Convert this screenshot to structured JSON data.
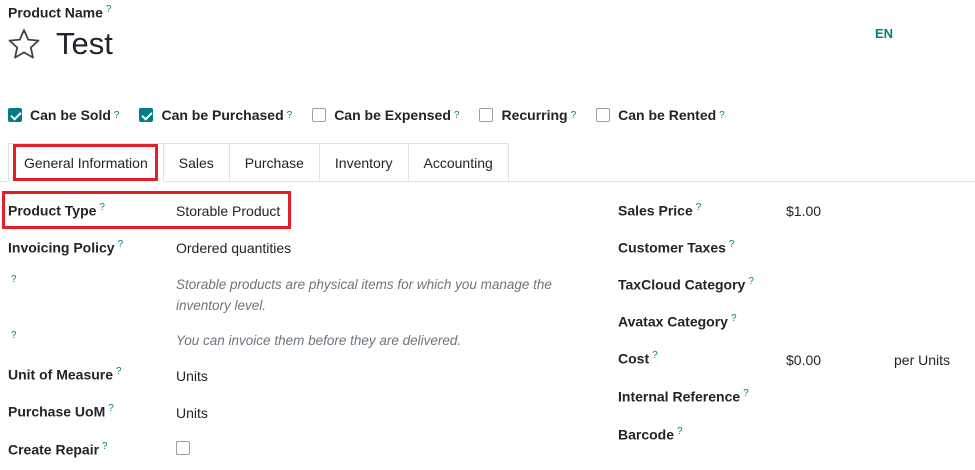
{
  "header": {
    "product_name_label": "Product Name",
    "help_mark": "?",
    "product_title": "Test",
    "language": "EN"
  },
  "options": [
    {
      "label": "Can be Sold",
      "checked": true
    },
    {
      "label": "Can be Purchased",
      "checked": true
    },
    {
      "label": "Can be Expensed",
      "checked": false
    },
    {
      "label": "Recurring",
      "checked": false
    },
    {
      "label": "Can be Rented",
      "checked": false
    }
  ],
  "tabs": [
    "General Information",
    "Sales",
    "Purchase",
    "Inventory",
    "Accounting"
  ],
  "left_fields": {
    "product_type": {
      "label": "Product Type",
      "value": "Storable Product"
    },
    "invoicing_policy": {
      "label": "Invoicing Policy",
      "value": "Ordered quantities"
    },
    "note1": "Storable products are physical items for which you manage the inventory level.",
    "note2": "You can invoice them before they are delivered.",
    "unit_of_measure": {
      "label": "Unit of Measure",
      "value": "Units"
    },
    "purchase_uom": {
      "label": "Purchase UoM",
      "value": "Units"
    },
    "create_repair": {
      "label": "Create Repair",
      "checked": false
    }
  },
  "right_fields": {
    "sales_price": {
      "label": "Sales Price",
      "value": "$1.00"
    },
    "customer_taxes": {
      "label": "Customer Taxes",
      "value": ""
    },
    "taxcloud_category": {
      "label": "TaxCloud Category",
      "value": ""
    },
    "avatax_category": {
      "label": "Avatax Category",
      "value": ""
    },
    "cost": {
      "label": "Cost",
      "value": "$0.00",
      "unit": "per Units"
    },
    "internal_reference": {
      "label": "Internal Reference",
      "value": ""
    },
    "barcode": {
      "label": "Barcode",
      "value": ""
    }
  },
  "colors": {
    "accent": "#017e84",
    "highlight": "#e31e24"
  }
}
